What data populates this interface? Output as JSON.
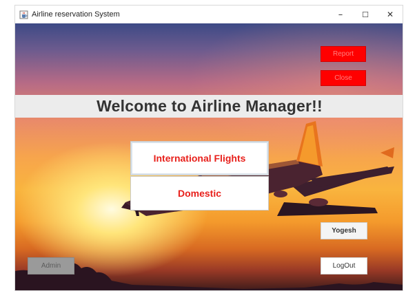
{
  "window": {
    "title": "Airline reservation System",
    "controls": {
      "minimize": "–",
      "maximize": "☐",
      "close": "✕"
    }
  },
  "header": {
    "welcome": "Welcome to Airline Manager!!"
  },
  "top_buttons": {
    "report_label": "Report",
    "close_label": "Close"
  },
  "flights": {
    "international_label": "International Flights",
    "domestic_label": "Domestic"
  },
  "user": {
    "name": "Yogesh",
    "logout_label": "LogOut",
    "admin_label": "Admin"
  },
  "colors": {
    "red_button": "#ff0000",
    "flight_text": "#e8201b",
    "banner_bg": "#ececec"
  },
  "icons": {
    "app": "java-cup-icon",
    "minimize": "minimize-icon",
    "maximize": "maximize-icon",
    "close": "close-icon"
  }
}
